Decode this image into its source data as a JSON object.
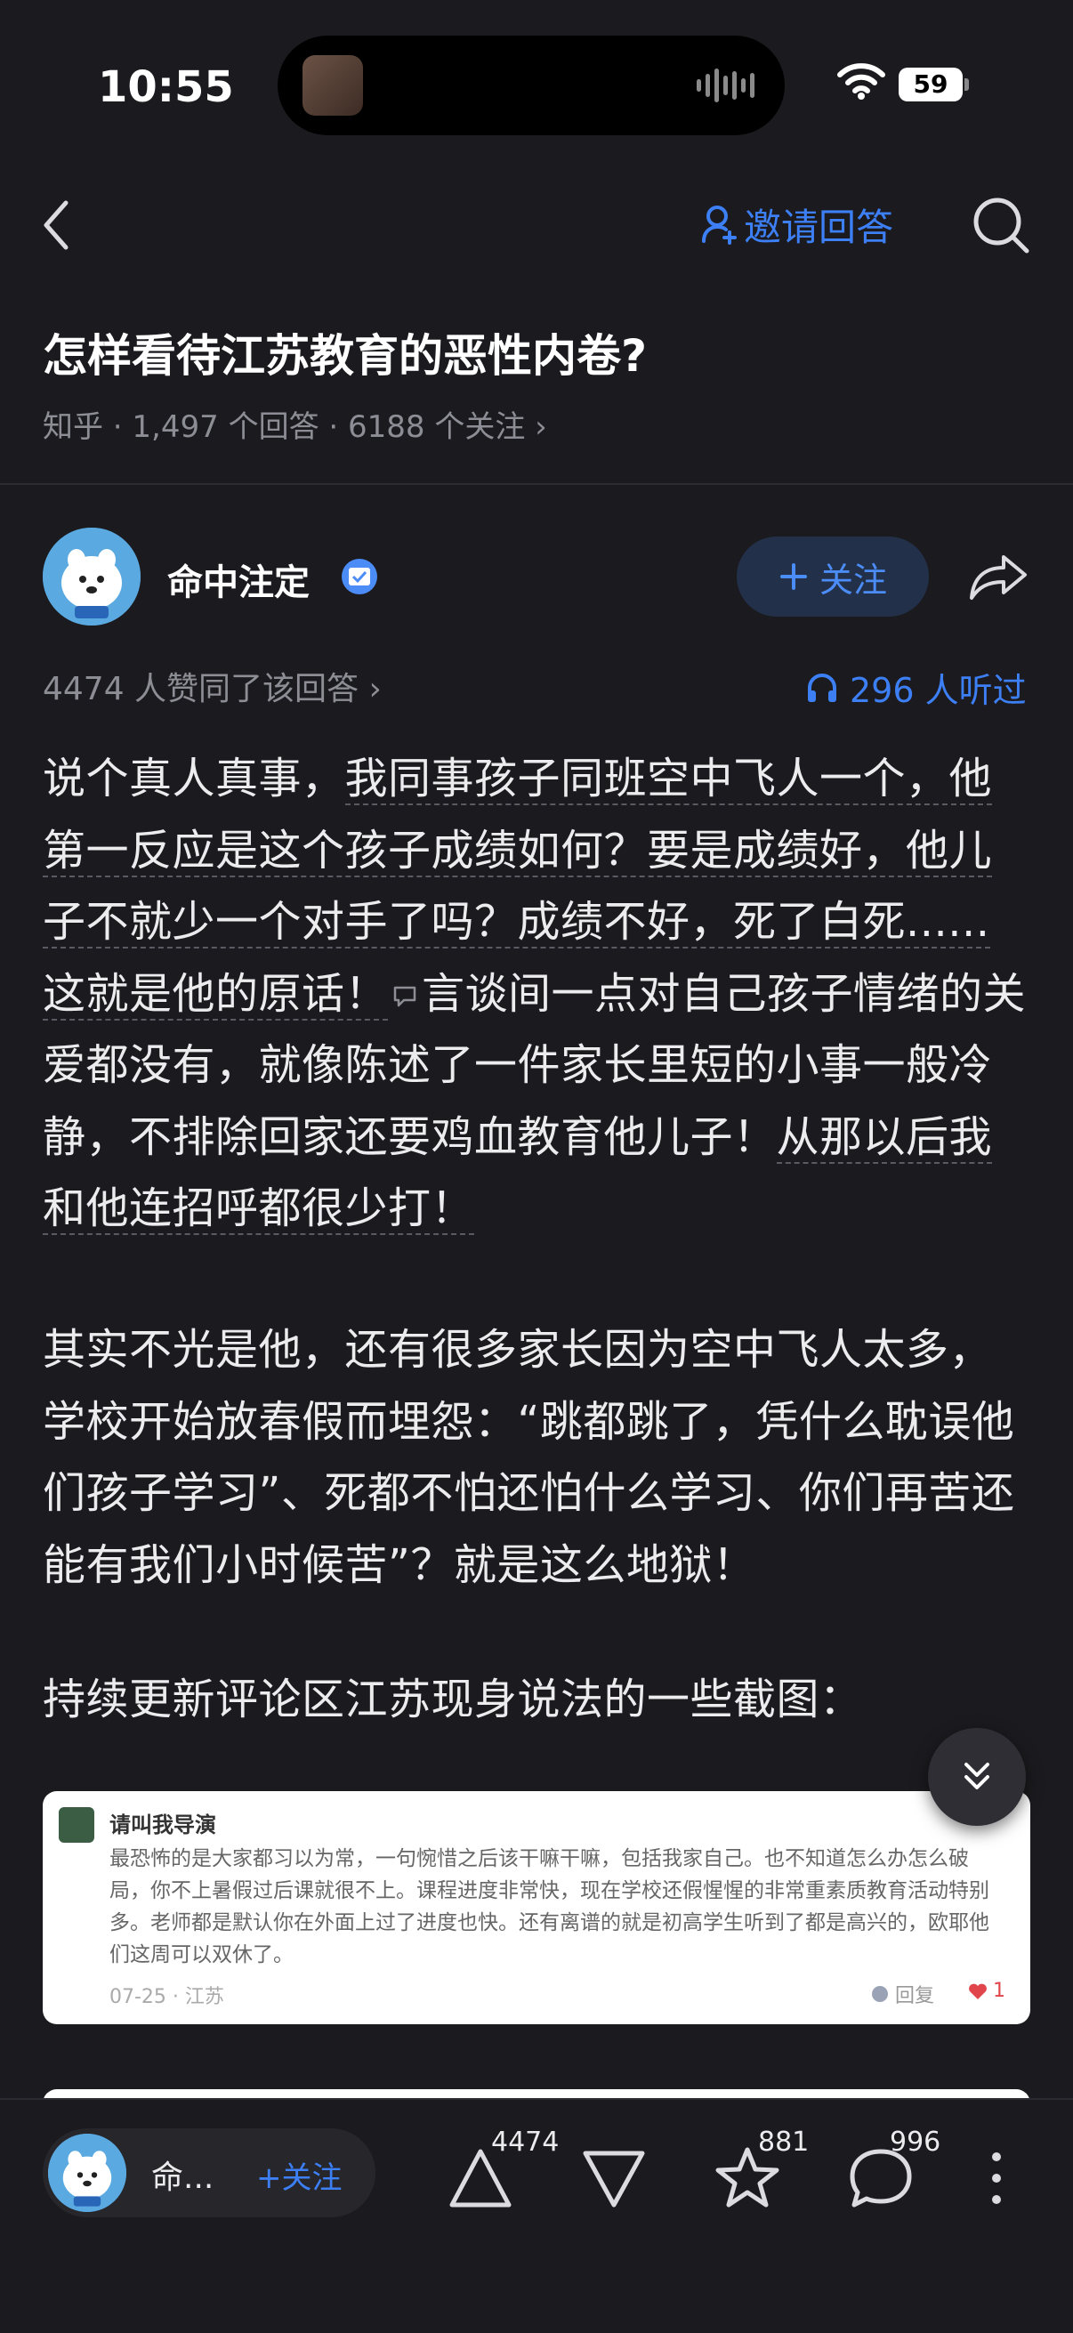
{
  "status_bar": {
    "time": "10:55",
    "battery": "59"
  },
  "nav": {
    "invite_label": "邀请回答"
  },
  "question": {
    "title": "怎样看待江苏教育的恶性内卷?",
    "meta": "知乎 · 1,497 个回答 · 6188 个关注 ›"
  },
  "author": {
    "name": "命中注定",
    "follow_label": "关注"
  },
  "answer_stats": {
    "agree_text": "4474 人赞同了该回答 ›",
    "listen_text": "296 人听过"
  },
  "content": {
    "p1_a": "说个真人真事，",
    "p1_b": "我同事孩子同班空中飞人一个，他第一反应是这个孩子成绩如何？要是成绩好，他儿子不就少一个对手了吗？成绩不好，死了白死......这就是他的原话！",
    "p1_c": "言谈间一点对自己孩子情绪的关爱都没有，就像陈述了一件家长里短的小事一般冷静，不排除回家还要鸡血教育他儿子！",
    "p1_d": "从那以后我和他连招呼都很少打！",
    "p2": "其实不光是他，还有很多家长因为空中飞人太多，学校开始放春假而埋怨：“跳都跳了，凭什么耽误他们孩子学习”、死都不怕还怕什么学习、你们再苦还能有我们小时候苦”？就是这么地狱！",
    "p3": "持续更新评论区江苏现身说法的一些截图："
  },
  "comment_card": {
    "user": "请叫我导演",
    "text": "最恐怖的是大家都习以为常，一句惋惜之后该干嘛干嘛，包括我家自己。也不知道怎么办怎么破局，你不上暑假过后课就很不上。课程进度非常快，现在学校还假惺惺的非常重素质教育活动特别多。老师都是默认你在外面上过了进度也快。还有离谱的就是初高学生听到了都是高兴的，欧耶他们这周可以双休了。",
    "meta": "07-25 · 江苏",
    "reply_label": "回复",
    "likes": "1"
  },
  "bottom_bar": {
    "author_short": "命...",
    "follow_label": "+关注",
    "upvotes": "4474",
    "favorites": "881",
    "comments": "996"
  },
  "colors": {
    "accent": "#3d7ff5",
    "background": "#1b1b1f",
    "like_red": "#e0454b"
  }
}
